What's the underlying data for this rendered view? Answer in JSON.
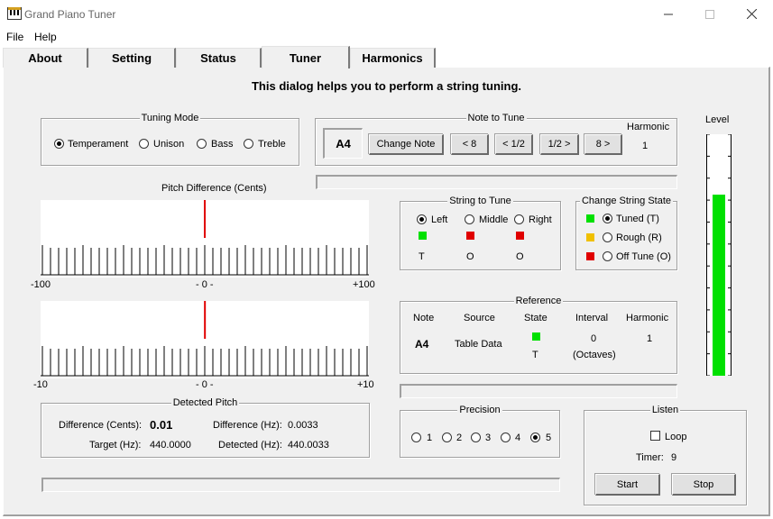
{
  "window": {
    "title": "Grand Piano Tuner"
  },
  "menu": [
    "File",
    "Help"
  ],
  "tabs": [
    "About",
    "Setting",
    "Status",
    "Tuner",
    "Harmonics"
  ],
  "active_tab": "Tuner",
  "heading": "This dialog helps you to perform a string tuning.",
  "tuning_mode": {
    "label": "Tuning Mode",
    "options": [
      "Temperament",
      "Unison",
      "Bass",
      "Treble"
    ],
    "selected": "Temperament"
  },
  "note_to_tune": {
    "label": "Note to Tune",
    "note": "A4",
    "change_button": "Change Note",
    "nav_buttons": [
      "< 8",
      "< 1/2",
      "1/2 >",
      "8 >"
    ],
    "harmonic_label": "Harmonic",
    "harmonic_value": "1"
  },
  "pitch_difference": {
    "title": "Pitch Difference (Cents)",
    "coarse": {
      "min_label": "-100",
      "mid_label": "- 0 -",
      "max_label": "+100",
      "value": 0.01
    },
    "fine": {
      "min_label": "-10",
      "mid_label": "- 0 -",
      "max_label": "+10",
      "value": 0.01
    },
    "indicator_color": "#e00000"
  },
  "string_to_tune": {
    "label": "String to Tune",
    "options": [
      "Left",
      "Middle",
      "Right"
    ],
    "selected": "Left",
    "colors": [
      "#00e000",
      "#e00000",
      "#e00000"
    ],
    "states": [
      "T",
      "O",
      "O"
    ]
  },
  "change_string_state": {
    "label": "Change String State",
    "options": [
      "Tuned (T)",
      "Rough (R)",
      "Off Tune (O)"
    ],
    "colors": [
      "#00e000",
      "#f0c000",
      "#e00000"
    ],
    "selected": "Tuned (T)"
  },
  "reference": {
    "label": "Reference",
    "headers": [
      "Note",
      "Source",
      "State",
      "Interval",
      "Harmonic"
    ],
    "note": "A4",
    "source": "Table Data",
    "state_color": "#00e000",
    "state": "T",
    "interval": "0",
    "interval_unit": "(Octaves)",
    "harmonic": "1"
  },
  "detected_pitch": {
    "label": "Detected Pitch",
    "difference_cents_label": "Difference (Cents):",
    "difference_cents": "0.01",
    "difference_hz_label": "Difference (Hz):",
    "difference_hz": "0.0033",
    "target_label": "Target (Hz):",
    "target": "440.0000",
    "detected_label": "Detected (Hz):",
    "detected": "440.0033"
  },
  "precision": {
    "label": "Precision",
    "options": [
      "1",
      "2",
      "3",
      "4",
      "5"
    ],
    "selected": "5"
  },
  "listen": {
    "label": "Listen",
    "loop_label": "Loop",
    "loop_checked": false,
    "timer_label": "Timer:",
    "timer_value": "9",
    "start_button": "Start",
    "stop_button": "Stop"
  },
  "level": {
    "label": "Level",
    "fill_fraction": 0.75,
    "color": "#00e000"
  }
}
